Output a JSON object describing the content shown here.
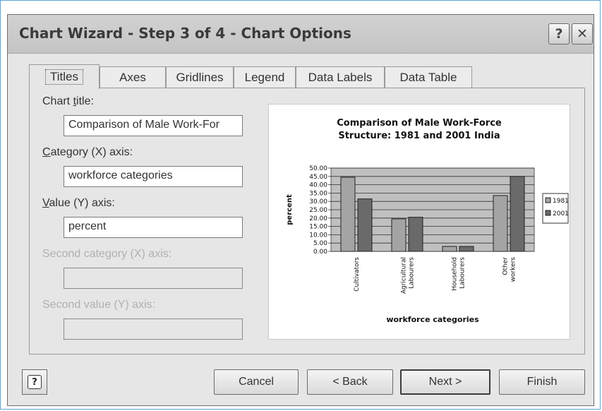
{
  "window": {
    "title": "Chart Wizard - Step 3 of 4 - Chart Options",
    "help_glyph": "?",
    "close_glyph": "✕"
  },
  "tabs": [
    {
      "label": "Titles",
      "active": true
    },
    {
      "label": "Axes"
    },
    {
      "label": "Gridlines"
    },
    {
      "label": "Legend"
    },
    {
      "label": "Data Labels"
    },
    {
      "label": "Data Table"
    }
  ],
  "fields": {
    "chart_title": {
      "label_pre": "Chart ",
      "label_key": "t",
      "label_post": "itle:",
      "value": "Comparison of Male Work-For"
    },
    "category_x": {
      "label_pre": "",
      "label_key": "C",
      "label_post": "ategory (X) axis:",
      "value": "workforce categories"
    },
    "value_y": {
      "label_pre": "",
      "label_key": "V",
      "label_post": "alue (Y) axis:",
      "value": "percent"
    },
    "second_category_x": {
      "label": "Second category (X) axis:",
      "value": ""
    },
    "second_value_y": {
      "label": "Second value (Y) axis:",
      "value": ""
    }
  },
  "buttons": {
    "help_glyph": "?",
    "cancel": "Cancel",
    "back": "< Back",
    "next": "Next >",
    "finish": "Finish"
  },
  "chart_data": {
    "type": "bar",
    "title_line1": "Comparison of Male Work-Force",
    "title_line2": "Structure: 1981 and 2001 India",
    "xlabel": "workforce categories",
    "ylabel": "percent",
    "categories": [
      [
        "Cultivators"
      ],
      [
        "Agricultural",
        "Labourers"
      ],
      [
        "Household",
        "Labourers"
      ],
      [
        "Other",
        "workers"
      ]
    ],
    "series": [
      {
        "name": "1981",
        "values": [
          44.5,
          19.5,
          3,
          33.5
        ],
        "color": "#a4a4a4"
      },
      {
        "name": "2001",
        "values": [
          31.5,
          20.5,
          3,
          45
        ],
        "color": "#6a6a6a"
      }
    ],
    "ylim": [
      0,
      50
    ],
    "yticks": [
      "0.00",
      "5.00",
      "10.00",
      "15.00",
      "20.00",
      "25.00",
      "30.00",
      "35.00",
      "40.00",
      "45.00",
      "50.00"
    ],
    "plot_bg": "#c0c0c0",
    "grid": true,
    "legend_position": "right"
  }
}
